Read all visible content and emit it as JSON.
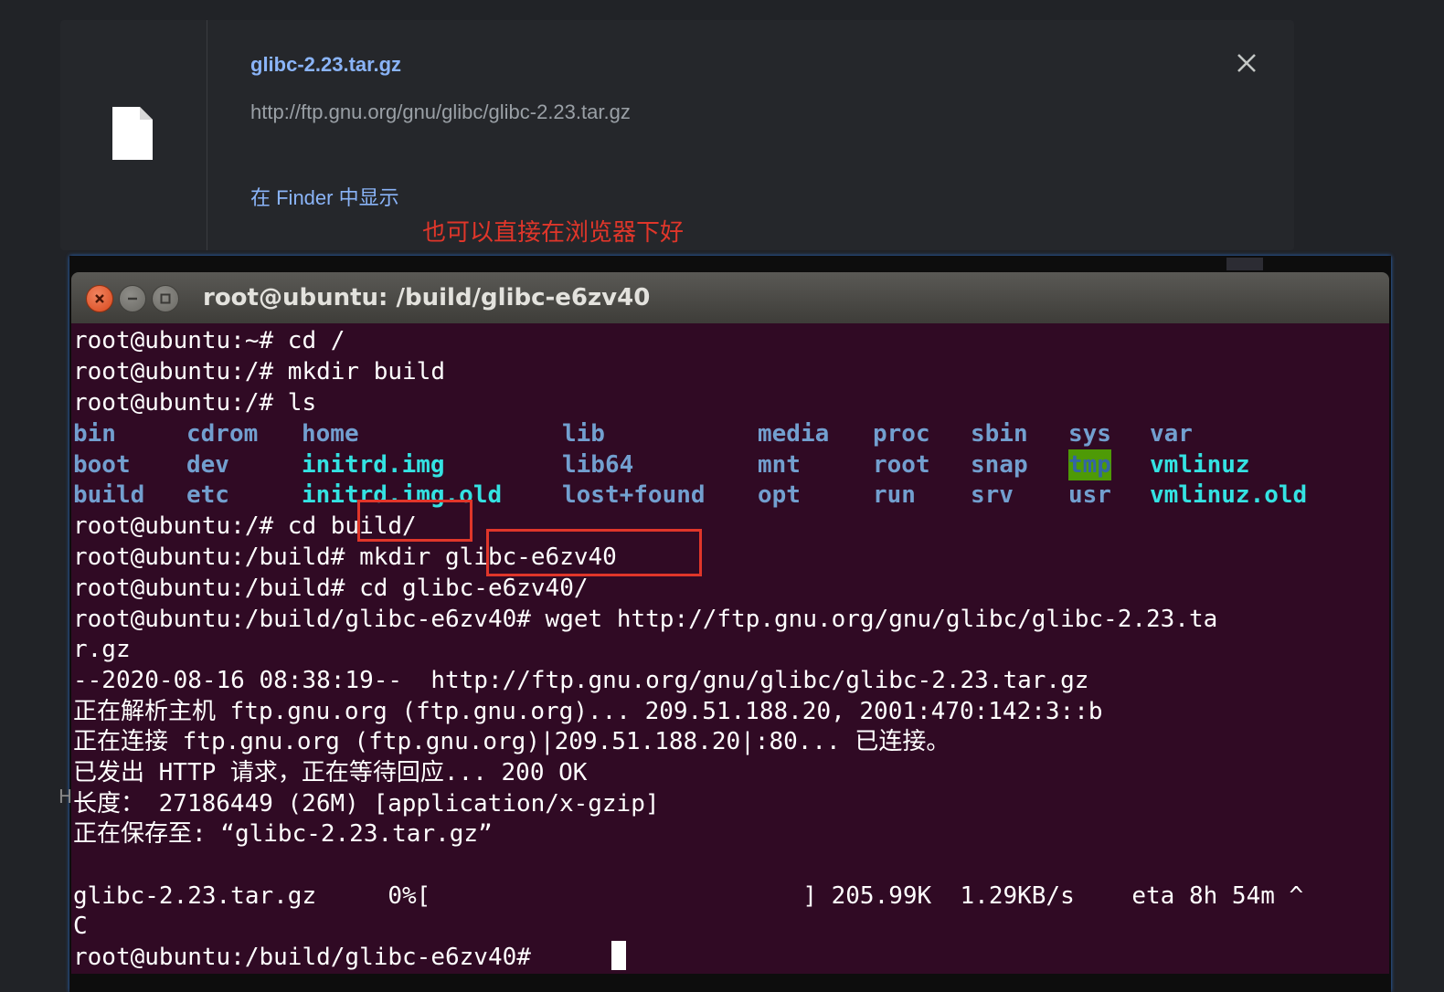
{
  "download": {
    "filename": "glibc-2.23.tar.gz",
    "url": "http://ftp.gnu.org/gnu/glibc/glibc-2.23.tar.gz",
    "finder_link": "在 Finder 中显示",
    "close_icon": "close-icon",
    "file_icon": "file-icon"
  },
  "annotation": "也可以直接在浏览器下好",
  "terminal": {
    "title": "root@ubuntu: /build/glibc-e6zv40",
    "lines_before_ls": [
      "root@ubuntu:~# cd /",
      "root@ubuntu:/# mkdir build",
      "root@ubuntu:/# ls"
    ],
    "ls_rows": [
      [
        {
          "text": "bin",
          "type": "dir"
        },
        {
          "text": "cdrom",
          "type": "dir"
        },
        {
          "text": "home",
          "type": "dir"
        },
        {
          "text": "lib",
          "type": "dir"
        },
        {
          "text": "media",
          "type": "dir"
        },
        {
          "text": "proc",
          "type": "dir"
        },
        {
          "text": "sbin",
          "type": "dir"
        },
        {
          "text": "sys",
          "type": "dir"
        },
        {
          "text": "var",
          "type": "dir"
        }
      ],
      [
        {
          "text": "boot",
          "type": "dir"
        },
        {
          "text": "dev",
          "type": "dir"
        },
        {
          "text": "initrd.img",
          "type": "link"
        },
        {
          "text": "lib64",
          "type": "dir"
        },
        {
          "text": "mnt",
          "type": "dir"
        },
        {
          "text": "root",
          "type": "dir"
        },
        {
          "text": "snap",
          "type": "dir"
        },
        {
          "text": "tmp",
          "type": "tmp"
        },
        {
          "text": "vmlinuz",
          "type": "link"
        }
      ],
      [
        {
          "text": "build",
          "type": "dir"
        },
        {
          "text": "etc",
          "type": "dir"
        },
        {
          "text": "initrd.img.old",
          "type": "link"
        },
        {
          "text": "lost+found",
          "type": "dir"
        },
        {
          "text": "opt",
          "type": "dir"
        },
        {
          "text": "run",
          "type": "dir"
        },
        {
          "text": "srv",
          "type": "dir"
        },
        {
          "text": "usr",
          "type": "dir"
        },
        {
          "text": "vmlinuz.old",
          "type": "link"
        }
      ]
    ],
    "lines_after_ls": [
      "root@ubuntu:/# cd build/",
      "root@ubuntu:/build# mkdir glibc-e6zv40",
      "root@ubuntu:/build# cd glibc-e6zv40/",
      "root@ubuntu:/build/glibc-e6zv40# wget http://ftp.gnu.org/gnu/glibc/glibc-2.23.ta",
      "r.gz",
      "--2020-08-16 08:38:19--  http://ftp.gnu.org/gnu/glibc/glibc-2.23.tar.gz",
      "正在解析主机 ftp.gnu.org (ftp.gnu.org)... 209.51.188.20, 2001:470:142:3::b",
      "正在连接 ftp.gnu.org (ftp.gnu.org)|209.51.188.20|:80... 已连接。",
      "已发出 HTTP 请求，正在等待回应... 200 OK",
      "长度： 27186449 (26M) [application/x-gzip]",
      "正在保存至: “glibc-2.23.tar.gz”",
      "",
      "glibc-2.23.tar.gz     0%[                          ] 205.99K  1.29KB/s    eta 8h 54m ^",
      "C",
      "root@ubuntu:/build/glibc-e6zv40# "
    ],
    "colors": {
      "background": "#300a24",
      "dir": "#729fcf",
      "link": "#34e2e2",
      "tmp_bg": "#4e9a06",
      "highlight_box": "#e0362a"
    }
  }
}
